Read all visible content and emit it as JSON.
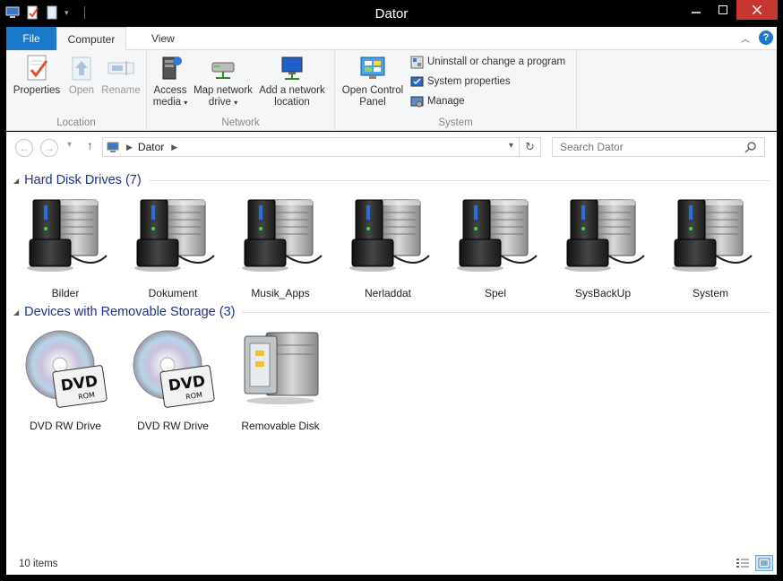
{
  "window": {
    "title": "Dator"
  },
  "ribbon_tabs": {
    "file": "File",
    "computer": "Computer",
    "view": "View"
  },
  "ribbon": {
    "location": {
      "label": "Location",
      "buttons": [
        {
          "label": "Properties",
          "icon": "properties-icon",
          "enabled": true
        },
        {
          "label": "Open",
          "icon": "open-icon",
          "enabled": false
        },
        {
          "label": "Rename",
          "icon": "rename-icon",
          "enabled": false
        }
      ]
    },
    "network": {
      "label": "Network",
      "access_media": {
        "line1": "Access",
        "line2": "media"
      },
      "map_drive": {
        "line1": "Map network",
        "line2": "drive"
      },
      "add_location": {
        "line1": "Add a network",
        "line2": "location"
      }
    },
    "system": {
      "label": "System",
      "control_panel": {
        "line1": "Open Control",
        "line2": "Panel"
      },
      "uninstall": "Uninstall or change a program",
      "system_properties": "System properties",
      "manage": "Manage"
    }
  },
  "address": {
    "crumb": "Dator",
    "search_placeholder": "Search Dator"
  },
  "groups": {
    "hdd": {
      "title": "Hard Disk Drives (7)",
      "items": [
        "Bilder",
        "Dokument",
        "Musik_Apps",
        "Nerladdat",
        "Spel",
        "SysBackUp",
        "System"
      ]
    },
    "removable": {
      "title": "Devices with Removable Storage (3)",
      "items": [
        "DVD RW Drive",
        "DVD RW Drive",
        "Removable Disk"
      ]
    }
  },
  "dvd_badge": {
    "top": "DVD",
    "bottom": "ROM"
  },
  "status": {
    "items": "10 items"
  },
  "colors": {
    "accent": "#1979ca",
    "close": "#c7372f",
    "group_title": "#1e3287"
  }
}
